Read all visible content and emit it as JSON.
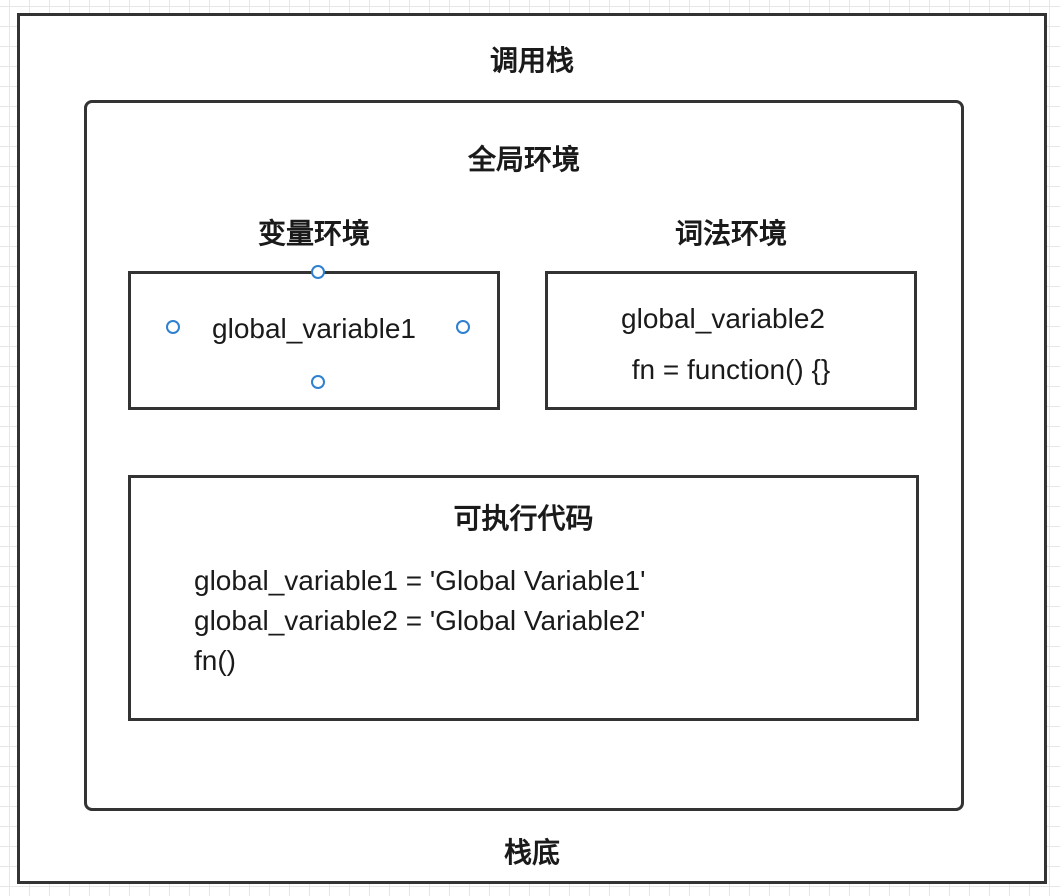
{
  "diagram": {
    "call_stack_title": "调用栈",
    "stack_bottom_label": "栈底",
    "global_context": {
      "title": "全局环境",
      "variable_environment": {
        "title": "变量环境",
        "entries": [
          "global_variable1"
        ]
      },
      "lexical_environment": {
        "title": "词法环境",
        "entries": [
          "global_variable2",
          "fn = function() {}"
        ]
      },
      "executable_code": {
        "title": "可执行代码",
        "lines": [
          "global_variable1 = 'Global Variable1'",
          "global_variable2 = 'Global Variable2'",
          "fn()"
        ]
      }
    },
    "colors": {
      "border": "#333333",
      "grid": "#e6e6e6",
      "selection_handle": "#2f80d1"
    }
  }
}
